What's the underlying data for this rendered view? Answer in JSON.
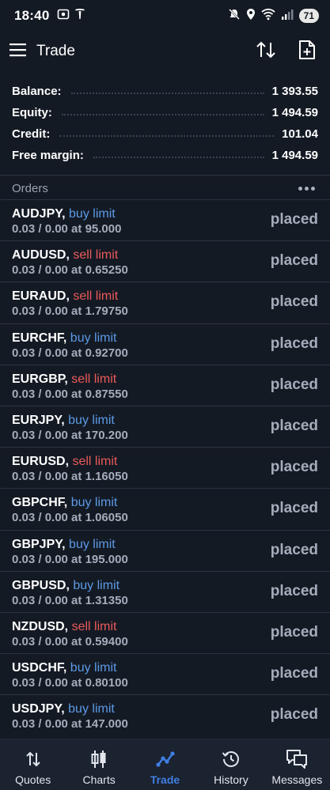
{
  "status_bar": {
    "time": "18:40",
    "battery": "71",
    "icons": [
      "screen-record-icon",
      "tesla-icon",
      "mute-icon",
      "location-icon",
      "wifi-icon",
      "signal-icon"
    ]
  },
  "app_bar": {
    "title": "Trade",
    "icons": [
      "menu-icon",
      "sort-icon",
      "new-order-icon"
    ]
  },
  "account": {
    "balance_label": "Balance:",
    "balance_value": "1 393.55",
    "equity_label": "Equity:",
    "equity_value": "1 494.59",
    "credit_label": "Credit:",
    "credit_value": "101.04",
    "free_margin_label": "Free margin:",
    "free_margin_value": "1 494.59"
  },
  "orders": {
    "title": "Orders",
    "items": [
      {
        "symbol": "AUDJPY,",
        "type": "buy limit",
        "details": "0.03 / 0.00 at 95.000",
        "status": "placed"
      },
      {
        "symbol": "AUDUSD,",
        "type": "sell limit",
        "details": "0.03 / 0.00 at 0.65250",
        "status": "placed"
      },
      {
        "symbol": "EURAUD,",
        "type": "sell limit",
        "details": "0.03 / 0.00 at 1.79750",
        "status": "placed"
      },
      {
        "symbol": "EURCHF,",
        "type": "buy limit",
        "details": "0.03 / 0.00 at 0.92700",
        "status": "placed"
      },
      {
        "symbol": "EURGBP,",
        "type": "sell limit",
        "details": "0.03 / 0.00 at 0.87550",
        "status": "placed"
      },
      {
        "symbol": "EURJPY,",
        "type": "buy limit",
        "details": "0.03 / 0.00 at 170.200",
        "status": "placed"
      },
      {
        "symbol": "EURUSD,",
        "type": "sell limit",
        "details": "0.03 / 0.00 at 1.16050",
        "status": "placed"
      },
      {
        "symbol": "GBPCHF,",
        "type": "buy limit",
        "details": "0.03 / 0.00 at 1.06050",
        "status": "placed"
      },
      {
        "symbol": "GBPJPY,",
        "type": "buy limit",
        "details": "0.03 / 0.00 at 195.000",
        "status": "placed"
      },
      {
        "symbol": "GBPUSD,",
        "type": "buy limit",
        "details": "0.03 / 0.00 at 1.31350",
        "status": "placed"
      },
      {
        "symbol": "NZDUSD,",
        "type": "sell limit",
        "details": "0.03 / 0.00 at 0.59400",
        "status": "placed"
      },
      {
        "symbol": "USDCHF,",
        "type": "buy limit",
        "details": "0.03 / 0.00 at 0.80100",
        "status": "placed"
      },
      {
        "symbol": "USDJPY,",
        "type": "buy limit",
        "details": "0.03 / 0.00 at 147.000",
        "status": "placed"
      }
    ]
  },
  "bottom_nav": {
    "items": [
      {
        "label": "Quotes",
        "icon": "quotes-icon"
      },
      {
        "label": "Charts",
        "icon": "charts-icon"
      },
      {
        "label": "Trade",
        "icon": "trade-icon",
        "active": true
      },
      {
        "label": "History",
        "icon": "history-icon"
      },
      {
        "label": "Messages",
        "icon": "messages-icon"
      }
    ]
  },
  "colors": {
    "background": "#141a24",
    "buy": "#5c9ae6",
    "sell": "#ea5a5a",
    "muted": "#a4adbb",
    "active_nav": "#3f7fe0"
  }
}
